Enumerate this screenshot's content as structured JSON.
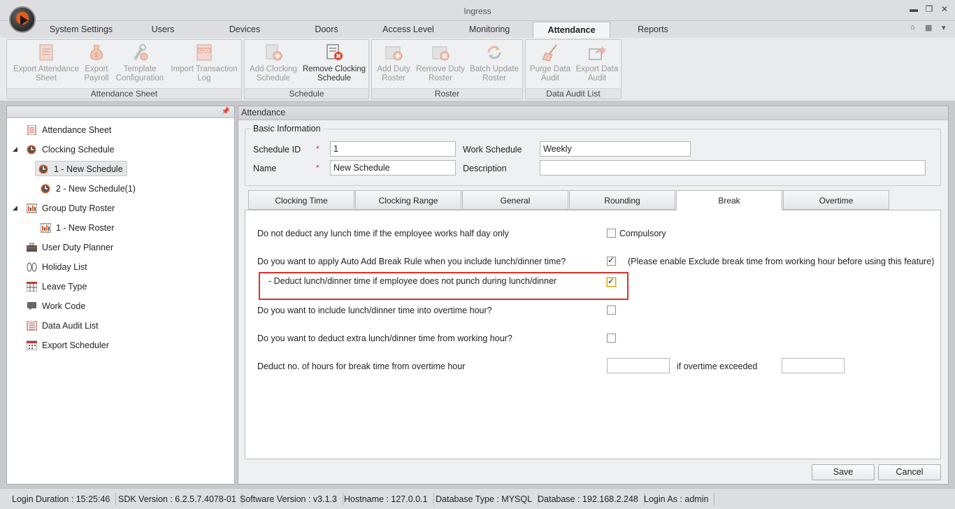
{
  "window": {
    "title": "Ingress"
  },
  "ribbon_tabs": [
    "System Settings",
    "Users",
    "Devices",
    "Doors",
    "Access Level",
    "Monitoring",
    "Attendance",
    "Reports"
  ],
  "active_tab": "Attendance",
  "ribbon": {
    "groups": [
      {
        "label": "Attendance Sheet",
        "buttons": [
          {
            "label": "Export Attendance\nSheet",
            "icon": "attendance-sheet-icon"
          },
          {
            "label": "Export\nPayroll",
            "icon": "money-bag-icon"
          },
          {
            "label": "Template\nConfiguration",
            "icon": "tools-icon"
          },
          {
            "label": "Import Transaction\nLog",
            "icon": "log-file-icon"
          }
        ]
      },
      {
        "label": "Schedule",
        "buttons": [
          {
            "label": "Add Clocking\nSchedule",
            "icon": "add-schedule-icon"
          },
          {
            "label": "Remove Clocking\nSchedule",
            "icon": "remove-schedule-icon"
          }
        ]
      },
      {
        "label": "Roster",
        "buttons": [
          {
            "label": "Add Duty\nRoster",
            "icon": "add-roster-icon"
          },
          {
            "label": "Remove Duty\nRoster",
            "icon": "remove-roster-icon"
          },
          {
            "label": "Batch Update\nRoster",
            "icon": "refresh-icon"
          }
        ]
      },
      {
        "label": "Data Audit List",
        "buttons": [
          {
            "label": "Purge Data\nAudit",
            "icon": "broom-icon"
          },
          {
            "label": "Export Data\nAudit",
            "icon": "export-icon"
          }
        ]
      }
    ]
  },
  "tree": {
    "items": [
      {
        "label": "Attendance Sheet",
        "icon": "sheet-icon"
      },
      {
        "label": "Clocking Schedule",
        "icon": "clock-icon"
      },
      {
        "label": "1 - New Schedule",
        "icon": "clock-icon"
      },
      {
        "label": "2 - New Schedule(1)",
        "icon": "clock-icon"
      },
      {
        "label": "Group Duty Roster",
        "icon": "roster-icon"
      },
      {
        "label": "1 - New Roster",
        "icon": "roster-icon"
      },
      {
        "label": "User Duty Planner",
        "icon": "briefcase-icon"
      },
      {
        "label": "Holiday List",
        "icon": "sandals-icon"
      },
      {
        "label": "Leave Type",
        "icon": "grid-icon"
      },
      {
        "label": "Work Code",
        "icon": "monitor-icon"
      },
      {
        "label": "Data Audit List",
        "icon": "list-icon"
      },
      {
        "label": "Export Scheduler",
        "icon": "calendar-icon"
      }
    ]
  },
  "main": {
    "header": "Attendance",
    "basic_info": {
      "legend": "Basic Information",
      "schedule_id_label": "Schedule ID",
      "schedule_id_value": "1",
      "name_label": "Name",
      "name_value": "New Schedule",
      "work_schedule_label": "Work Schedule",
      "work_schedule_value": "Weekly",
      "description_label": "Description",
      "description_value": "",
      "required_mark": "*"
    },
    "tabs": [
      "Clocking Time",
      "Clocking Range",
      "General",
      "Rounding",
      "Break",
      "Overtime"
    ],
    "active_tab": "Break",
    "break": {
      "q1": "Do not deduct any lunch time if the employee works half day only",
      "q1_option": "Compulsory",
      "q1_checked": false,
      "q2": "Do you want to apply Auto Add Break Rule when you include lunch/dinner time?",
      "q2_note": "(Please enable Exclude break time from working hour before using this feature)",
      "q2_checked": true,
      "q3": "- Deduct lunch/dinner time if employee does not punch during lunch/dinner",
      "q3_checked": true,
      "q4": "Do you want to include lunch/dinner time into overtime hour?",
      "q4_checked": false,
      "q5": "Do you want to deduct extra lunch/dinner time from working hour?",
      "q5_checked": false,
      "q6": "Deduct no. of hours for break time from overtime hour",
      "q6_suffix": "if overtime exceeded",
      "q6_value1": "",
      "q6_value2": ""
    },
    "buttons": {
      "save": "Save",
      "cancel": "Cancel"
    }
  },
  "status": {
    "login_duration": "Login Duration : 15:25:46",
    "sdk_version": "SDK Version : 6.2.5.7.4078-01",
    "software_version": "Software Version : v3.1.3",
    "hostname": "Hostname : 127.0.0.1",
    "database_type": "Database Type : MYSQL",
    "database": "Database : 192.168.2.248",
    "login_as": "Login As : admin"
  },
  "colors": {
    "highlight": "#e0302a",
    "accent": "#e85c1b",
    "required": "#d0302f"
  }
}
